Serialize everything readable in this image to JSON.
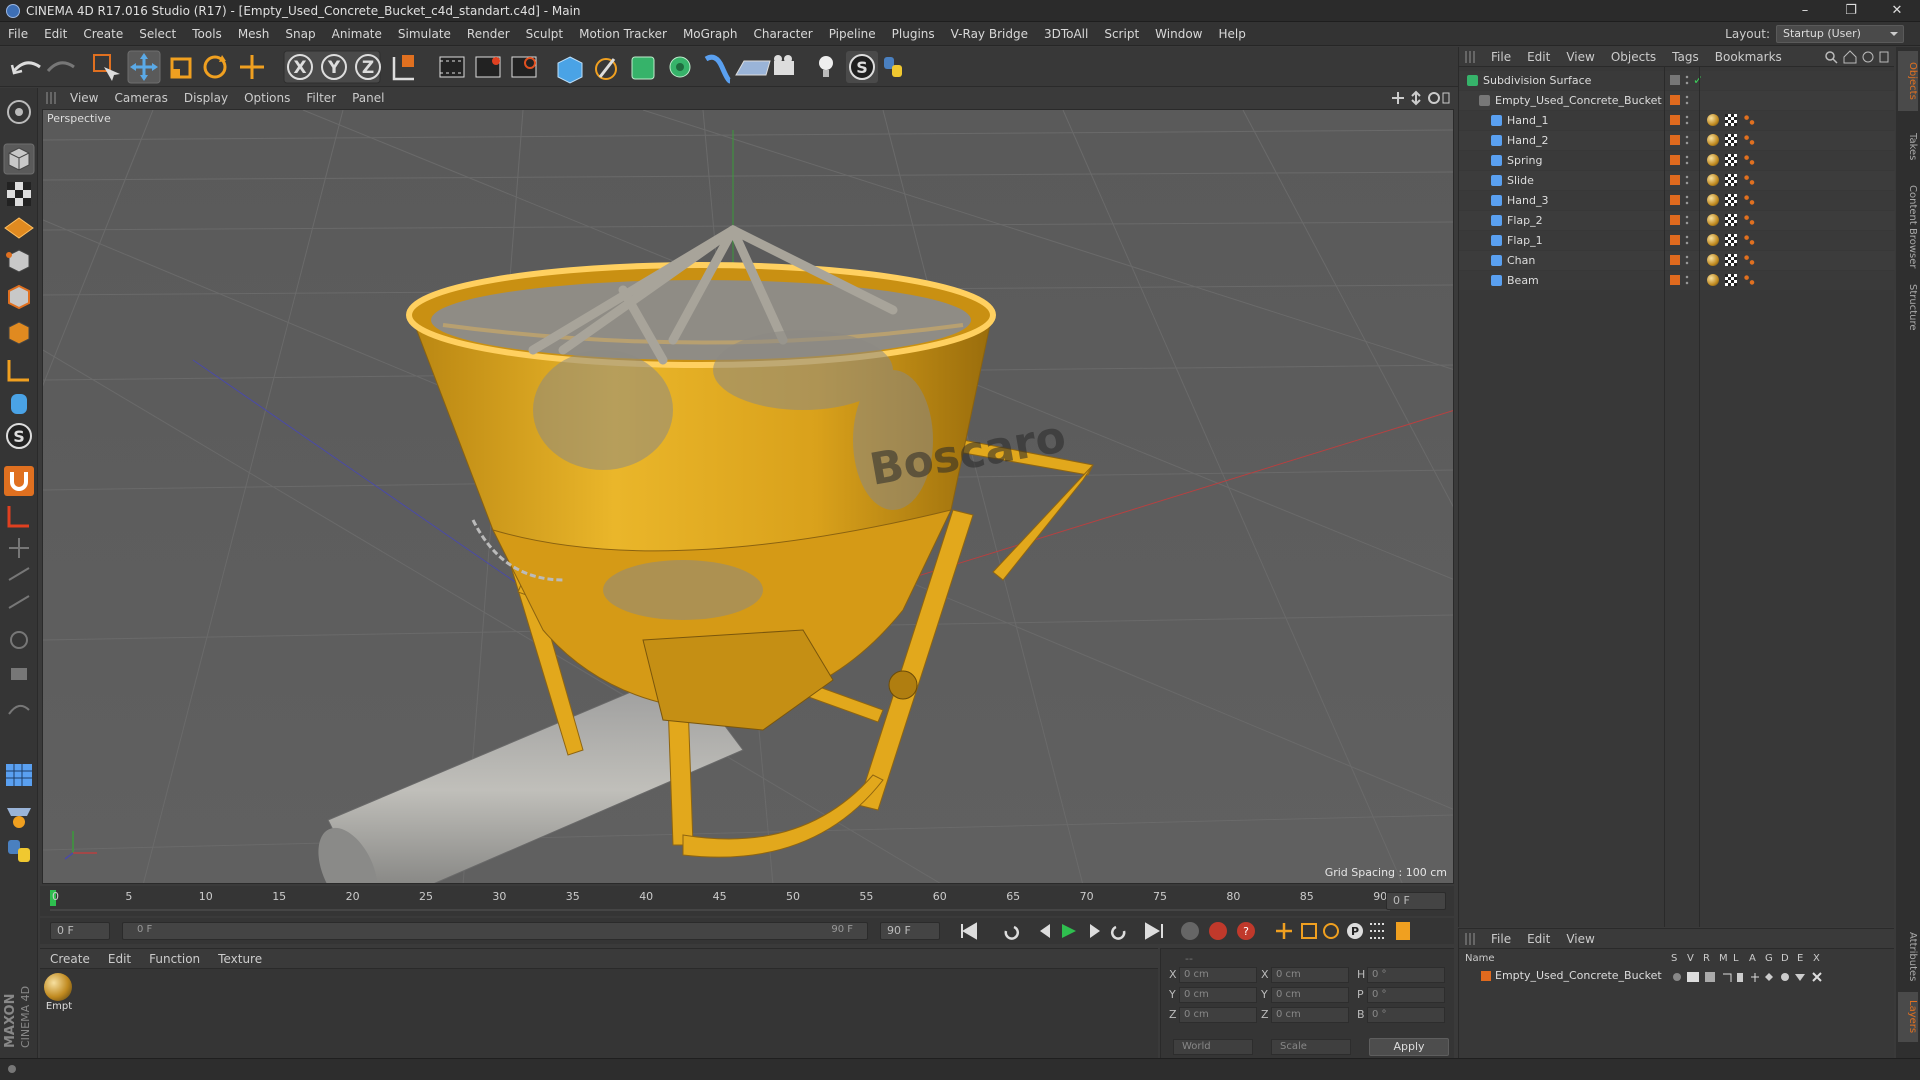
{
  "window": {
    "title": "CINEMA 4D R17.016 Studio (R17) - [Empty_Used_Concrete_Bucket_c4d_standart.c4d] - Main",
    "minimize": "–",
    "restore": "❐",
    "close": "✕"
  },
  "menu": [
    "File",
    "Edit",
    "Create",
    "Select",
    "Tools",
    "Mesh",
    "Snap",
    "Animate",
    "Simulate",
    "Render",
    "Sculpt",
    "Motion Tracker",
    "MoGraph",
    "Character",
    "Pipeline",
    "Plugins",
    "V-Ray Bridge",
    "3DToAll",
    "Script",
    "Window",
    "Help"
  ],
  "layout": {
    "label": "Layout:",
    "value": "Startup (User)"
  },
  "viewport": {
    "menu": [
      "View",
      "Cameras",
      "Display",
      "Options",
      "Filter",
      "Panel"
    ],
    "label": "Perspective",
    "grid_spacing": "Grid Spacing : 100 cm",
    "product_text": "Boscaro"
  },
  "timeline": {
    "ticks": [
      "0",
      "5",
      "10",
      "15",
      "20",
      "25",
      "30",
      "35",
      "40",
      "45",
      "50",
      "55",
      "60",
      "65",
      "70",
      "75",
      "80",
      "85",
      "90"
    ],
    "current_frame": "0 F",
    "start_frame": "0 F",
    "range_start": "0 F",
    "range_end": "90 F",
    "end_frame": "90 F"
  },
  "material_panel": {
    "menu": [
      "Create",
      "Edit",
      "Function",
      "Texture"
    ],
    "material_name": "Empt"
  },
  "coordinates": {
    "header": "--",
    "rows": [
      {
        "a": "X",
        "av": "0 cm",
        "b": "X",
        "bv": "0 cm",
        "c": "H",
        "cv": "0 °"
      },
      {
        "a": "Y",
        "av": "0 cm",
        "b": "Y",
        "bv": "0 cm",
        "c": "P",
        "cv": "0 °"
      },
      {
        "a": "Z",
        "av": "0 cm",
        "b": "Z",
        "bv": "0 cm",
        "c": "B",
        "cv": "0 °"
      }
    ],
    "mode1": "World",
    "mode2": "Scale",
    "apply": "Apply"
  },
  "object_manager": {
    "menu": [
      "File",
      "Edit",
      "View",
      "Objects",
      "Tags",
      "Bookmarks"
    ],
    "objects": [
      {
        "name": "Subdivision Surface",
        "level": 0
      },
      {
        "name": "Empty_Used_Concrete_Bucket",
        "level": 1
      },
      {
        "name": "Hand_1",
        "level": 2
      },
      {
        "name": "Hand_2",
        "level": 2
      },
      {
        "name": "Spring",
        "level": 2
      },
      {
        "name": "Slide",
        "level": 2
      },
      {
        "name": "Hand_3",
        "level": 2
      },
      {
        "name": "Flap_2",
        "level": 2
      },
      {
        "name": "Flap_1",
        "level": 2
      },
      {
        "name": "Chan",
        "level": 2
      },
      {
        "name": "Beam",
        "level": 2
      }
    ]
  },
  "layer_manager": {
    "menu": [
      "File",
      "Edit",
      "View"
    ],
    "columns": [
      "Name",
      "S",
      "V",
      "R",
      "M",
      "L",
      "A",
      "G",
      "D",
      "E",
      "X"
    ],
    "layer": "Empty_Used_Concrete_Bucket"
  },
  "side_tabs": [
    "Objects",
    "Takes",
    "Content Browser",
    "Structure",
    "Attributes",
    "Layers"
  ],
  "branding": {
    "brand": "MAXON",
    "product": "CINEMA 4D"
  },
  "colors": {
    "accent_orange": "#e06a1e",
    "bucket_yellow": "#e9b21e",
    "selection": "#5b5b5b"
  }
}
